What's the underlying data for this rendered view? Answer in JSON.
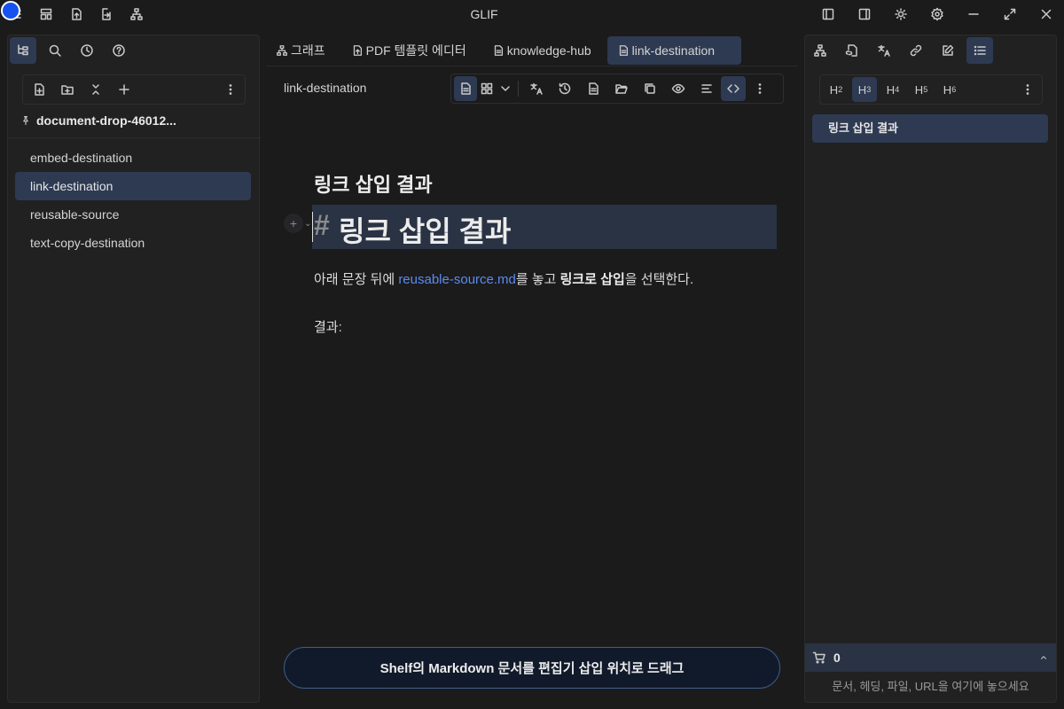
{
  "app": {
    "title": "GLIF"
  },
  "left_panel": {
    "project_name": "document-drop-46012...",
    "files": [
      {
        "label": "embed-destination",
        "active": false
      },
      {
        "label": "link-destination",
        "active": true
      },
      {
        "label": "reusable-source",
        "active": false
      },
      {
        "label": "text-copy-destination",
        "active": false
      }
    ]
  },
  "tabs": [
    {
      "label": "그래프",
      "icon": "graph-icon"
    },
    {
      "label": "PDF 템플릿 에디터",
      "icon": "pdf-template-icon"
    },
    {
      "label": "knowledge-hub",
      "icon": "document-icon"
    },
    {
      "label": "link-destination",
      "icon": "document-icon",
      "active": true
    }
  ],
  "editor": {
    "path": "link-destination",
    "heading": "링크 삽입 결과",
    "block_heading_hash": "#",
    "block_heading_text": "링크 삽입 결과",
    "paragraph": {
      "before": "아래 문장 뒤에 ",
      "link": "reusable-source.md",
      "middle": "를 놓고 ",
      "bold": "링크로 삽입",
      "after": "을 선택한다."
    },
    "result_label": "결과:",
    "shelf_drop_label": "Shelf의 Markdown 문서를 편집기 삽입 위치로 드래그"
  },
  "right_panel": {
    "heading_levels": [
      {
        "label": "H",
        "level": "2",
        "active": false
      },
      {
        "label": "H",
        "level": "3",
        "active": true
      },
      {
        "label": "H",
        "level": "4",
        "active": false
      },
      {
        "label": "H",
        "level": "5",
        "active": false
      },
      {
        "label": "H",
        "level": "6",
        "active": false
      }
    ],
    "outline": [
      "링크 삽입 결과"
    ],
    "cart_count": "0",
    "drop_hint": "문서, 헤딩, 파일, URL을 여기에 놓으세요"
  },
  "colors": {
    "accent": "#2e3a52",
    "link": "#5b8bf0",
    "app_dot": "#1652f0",
    "shelf_border": "#3f5d8f"
  }
}
